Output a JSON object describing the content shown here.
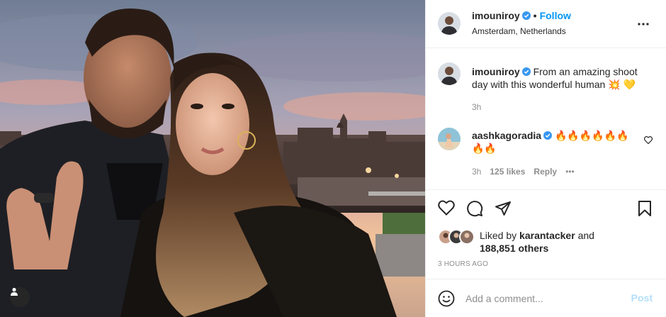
{
  "author": {
    "username": "imouniroy",
    "follow_label": "Follow",
    "separator": "•",
    "location": "Amsterdam, Netherlands"
  },
  "caption": {
    "username": "imouniroy",
    "text": "From an amazing shoot day with this wonderful human 💥 💛",
    "time": "3h"
  },
  "comment": {
    "username": "aashkagoradia",
    "text": "🔥🔥🔥🔥🔥🔥🔥🔥",
    "time": "3h",
    "likes": "125 likes",
    "reply_label": "Reply",
    "more_label": "•••"
  },
  "likes": {
    "prefix": "Liked by",
    "user": "karantacker",
    "suffix": "and",
    "others": "188,851 others"
  },
  "timestamp": "3 HOURS AGO",
  "add_comment": {
    "placeholder": "Add a comment...",
    "post_label": "Post"
  },
  "colors": {
    "link_blue": "#0095f6",
    "verified_blue": "#3897f0",
    "post_disabled": "#b2dffc",
    "muted": "#8e8e8e"
  },
  "icons": [
    "heart-icon",
    "comment-icon",
    "share-icon",
    "bookmark-icon",
    "emoji-icon",
    "more-icon",
    "verified-icon",
    "user-tag-icon",
    "like-comment-icon"
  ]
}
